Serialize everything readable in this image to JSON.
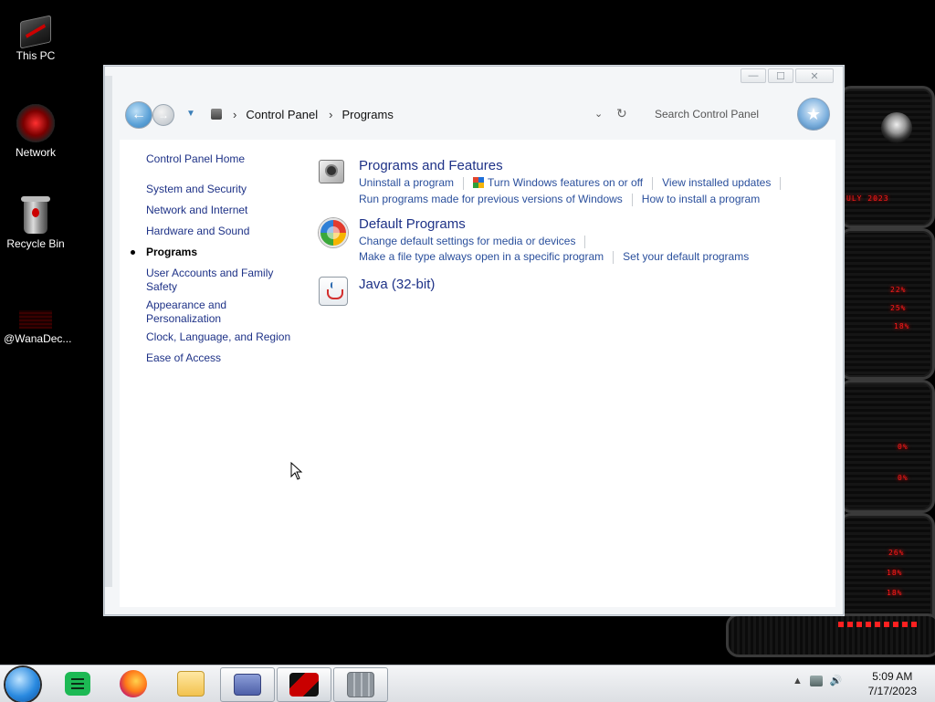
{
  "desktop": {
    "icons": [
      {
        "label": "This PC"
      },
      {
        "label": "Network"
      },
      {
        "label": "Recycle Bin"
      },
      {
        "label": "@WanaDec..."
      }
    ]
  },
  "window": {
    "caption": {
      "minimize": "—",
      "maximize": "☐",
      "close": "✕"
    },
    "address": {
      "root": "Control Panel",
      "current": "Programs",
      "separator": "›"
    },
    "search": {
      "placeholder": "Search Control Panel"
    },
    "nav": {
      "back": "←",
      "forward": "→",
      "recent": "▼",
      "refresh": "↻",
      "dropdown": "⌄"
    },
    "leftnav": [
      {
        "label": "Control Panel Home",
        "active": false
      },
      {
        "label": "System and Security",
        "active": false
      },
      {
        "label": "Network and Internet",
        "active": false
      },
      {
        "label": "Hardware and Sound",
        "active": false
      },
      {
        "label": "Programs",
        "active": true
      },
      {
        "label": "User Accounts and Family Safety",
        "active": false
      },
      {
        "label": "Appearance and Personalization",
        "active": false
      },
      {
        "label": "Clock, Language, and Region",
        "active": false
      },
      {
        "label": "Ease of Access",
        "active": false
      }
    ],
    "sections": [
      {
        "title": "Programs and Features",
        "icon": "programs-features-icon",
        "links": [
          [
            "Uninstall a program",
            "Turn Windows features on or off",
            "View installed updates"
          ],
          [
            "Run programs made for previous versions of Windows",
            "How to install a program"
          ]
        ]
      },
      {
        "title": "Default Programs",
        "icon": "default-programs-icon",
        "links": [
          [
            "Change default settings for media or devices"
          ],
          [
            "Make a file type always open in a specific program",
            "Set your default programs"
          ]
        ]
      },
      {
        "title": "Java (32-bit)",
        "icon": "java-icon",
        "links": []
      }
    ]
  },
  "widget": {
    "texts": [
      "ULY 2023",
      "22%",
      "25%",
      "18%",
      "0%",
      "0%",
      "26%",
      "18%",
      "18%"
    ]
  },
  "taskbar": {
    "clock": {
      "time": "5:09 AM",
      "date": "7/17/2023"
    },
    "tray": {
      "show_hidden": "▲",
      "volume": "🔊"
    }
  },
  "colors": {
    "link": "#1e3287",
    "desktop": "#000000",
    "accent_red": "#ff1a1a"
  }
}
